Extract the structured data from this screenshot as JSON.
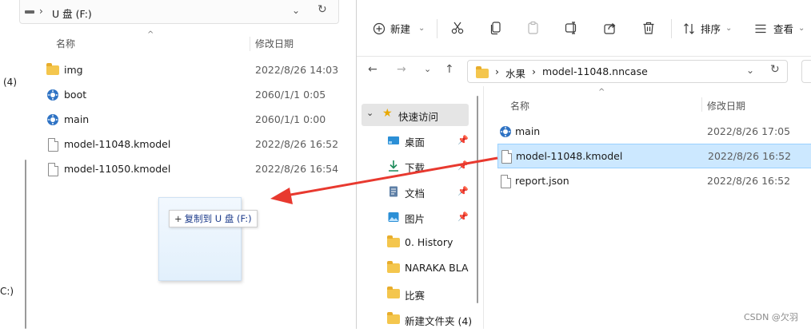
{
  "left_window": {
    "address": {
      "separator": "›",
      "path": "U 盘 (F:)",
      "dropdown": "⌄",
      "refresh": "↻"
    },
    "nav_stub": {
      "item1": "(4)",
      "item2": "C:)"
    },
    "columns": {
      "name": "名称",
      "date": "修改日期"
    },
    "files": [
      {
        "name": "img",
        "date": "2022/8/26 14:03",
        "icon": "folder-icon"
      },
      {
        "name": "boot",
        "date": "2060/1/1 0:05",
        "icon": "gear-icon"
      },
      {
        "name": "main",
        "date": "2060/1/1 0:00",
        "icon": "gear-icon"
      },
      {
        "name": "model-11048.kmodel",
        "date": "2022/8/26 16:52",
        "icon": "file-icon"
      },
      {
        "name": "model-11050.kmodel",
        "date": "2022/8/26 16:54",
        "icon": "file-icon"
      }
    ],
    "drag_tooltip": {
      "plus": "+",
      "text": "复制到 U 盘 (F:)"
    }
  },
  "right_window": {
    "toolbar": {
      "new_label": "新建",
      "sort_label": "排序",
      "view_label": "查看"
    },
    "address": {
      "crumbs": [
        "水果",
        "model-11048.nncase"
      ],
      "separator": "›",
      "dropdown": "⌄",
      "refresh": "↻"
    },
    "nav": {
      "back": "←",
      "forward": "→",
      "recent": "⌄",
      "up": "↑",
      "quick_access": "快速访问",
      "items": [
        {
          "label": "桌面",
          "icon": "desktop-icon",
          "pinned": true
        },
        {
          "label": "下载",
          "icon": "download-icon",
          "pinned": true
        },
        {
          "label": "文档",
          "icon": "document-icon",
          "pinned": true
        },
        {
          "label": "图片",
          "icon": "picture-icon",
          "pinned": true
        },
        {
          "label": "0. History",
          "icon": "folder-icon",
          "pinned": false
        },
        {
          "label": "NARAKA  BLA",
          "icon": "folder-icon",
          "pinned": false
        },
        {
          "label": "比赛",
          "icon": "folder-icon",
          "pinned": false
        },
        {
          "label": "新建文件夹 (4)",
          "icon": "folder-icon",
          "pinned": false
        }
      ]
    },
    "columns": {
      "name": "名称",
      "date": "修改日期"
    },
    "files": [
      {
        "name": "main",
        "date": "2022/8/26 17:05",
        "icon": "gear-icon",
        "selected": false
      },
      {
        "name": "model-11048.kmodel",
        "date": "2022/8/26 16:52",
        "icon": "file-icon",
        "selected": true
      },
      {
        "name": "report.json",
        "date": "2022/8/26 16:52",
        "icon": "file-icon",
        "selected": false
      }
    ]
  },
  "annotation": {
    "arrow_color": "#e8392f"
  },
  "watermark": "CSDN @欠羽"
}
